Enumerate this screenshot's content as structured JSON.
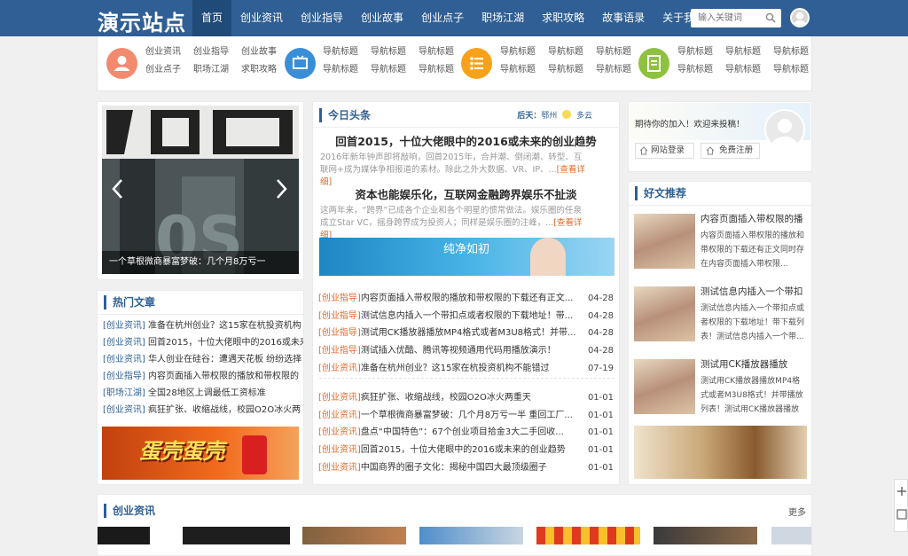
{
  "header": {
    "logo": "演示站点",
    "nav": [
      "首页",
      "创业资讯",
      "创业指导",
      "创业故事",
      "创业点子",
      "职场江湖",
      "求职攻略",
      "故事语录",
      "关于我们"
    ],
    "search_placeholder": "输入关键词"
  },
  "catbar": {
    "group1": [
      "创业资讯",
      "创业指导",
      "创业故事",
      "创业点子",
      "职场江湖",
      "求职攻略"
    ],
    "group_links": "导航标题",
    "colors": [
      "#f28a6d",
      "#3a8ed8",
      "#f7a21b",
      "#8dc13f"
    ]
  },
  "slider": {
    "caption": "一个草根微商暴富梦破：几个月8万亏一"
  },
  "hot": {
    "title": "热门文章",
    "items": [
      {
        "cat": "[创业资讯]",
        "text": "准备在杭州创业？这15家在杭投资机构"
      },
      {
        "cat": "[创业资讯]",
        "text": "回首2015，十位大佬眼中的2016或未来"
      },
      {
        "cat": "[创业资讯]",
        "text": "华人创业在硅谷：遭遇天花板 纷纷选择"
      },
      {
        "cat": "[创业指导]",
        "text": "内容页面插入带权限的播放和带权限的"
      },
      {
        "cat": "[职场江湖]",
        "text": "全国28地区上调最低工资标准"
      },
      {
        "cat": "[创业资讯]",
        "text": "疯狂扩张、收缩战线，校园O2O冰火两"
      }
    ],
    "banner_text": "蛋壳蛋壳"
  },
  "headline": {
    "title": "今日头条",
    "weather_label": "后天：",
    "weather_city": "鄂州",
    "weather_state": "多云",
    "story1_title": "回首2015，十位大佬眼中的2016或未来的创业趋势",
    "story1_desc": "2016年新年钟声即将敲响，回首2015年，合并潮、倒闭潮、转型、互联网+成为媒体争相报道的素材。除此之外大数据、VR、IP、...",
    "story2_title": "资本也能娱乐化，互联网金融跨界娱乐不扯淡",
    "story2_desc": "这两年来，“跨界”已成各个企业和各个明星的惯常做法。娱乐圈的任泉成立Star VC，摇身跨界成为投资人；同样是娱乐圈的注峰，...",
    "more": "[查看详细]",
    "ad_text": "纯净如初"
  },
  "news1": [
    {
      "cat": "[创业指导]",
      "text": "内容页面插入带权限的播放和带权限的下载还有正文...",
      "date": "04-28"
    },
    {
      "cat": "[创业指导]",
      "text": "测试信息内插入一个带扣点或者权限的下载地址！带...",
      "date": "04-28"
    },
    {
      "cat": "[创业指导]",
      "text": "测试用CK播放器播放MP4格式或者M3U8格式！并带...",
      "date": "04-28"
    },
    {
      "cat": "[创业指导]",
      "text": "测试插入优酷、腾讯等视频通用代码用播放演示！",
      "date": "04-28"
    },
    {
      "cat": "[创业资讯]",
      "text": "准备在杭州创业？这15家在杭投资机构不能错过",
      "date": "07-19"
    }
  ],
  "news2": [
    {
      "cat": "[创业资讯]",
      "text": "疯狂扩张、收缩战线，校园O2O冰火两重天",
      "date": "01-01"
    },
    {
      "cat": "[创业资讯]",
      "text": "一个草根微商暴富梦破：几个月8万亏一半 重回工厂...",
      "date": "01-01"
    },
    {
      "cat": "[创业资讯]",
      "text": "盘点“中国特色”：67个创业项目拾金3大二手回收...",
      "date": "01-01"
    },
    {
      "cat": "[创业资讯]",
      "text": "回首2015，十位大佬眼中的2016或未来的创业趋势",
      "date": "01-01"
    },
    {
      "cat": "[创业资讯]",
      "text": "中国商界的圈子文化：揭秘中国四大最顶级圈子",
      "date": "01-01"
    }
  ],
  "login": {
    "welcome": "期待你的加入！欢迎来投稿！",
    "login_btn": "网站登录",
    "register_btn": "免费注册"
  },
  "recommend": {
    "title": "好文推荐",
    "items": [
      {
        "title": "内容页面插入带权限的播",
        "desc": "内容页面插入带权限的播放和带权限的下载还有正文同时存在内容页面插入带权限..."
      },
      {
        "title": "测试信息内插入一个带扣",
        "desc": "测试信息内插入一个带扣点或者权限的下载地址！带下载列表！测试信息内插入一个带..."
      },
      {
        "title": "测试用CK播放器播放",
        "desc": "测试用CK播放器播放MP4格式或者M3U8格式！并带播放列表！测试用CK播放器播放MP4"
      }
    ]
  },
  "bottom": {
    "title": "创业资讯",
    "more": "更多"
  }
}
